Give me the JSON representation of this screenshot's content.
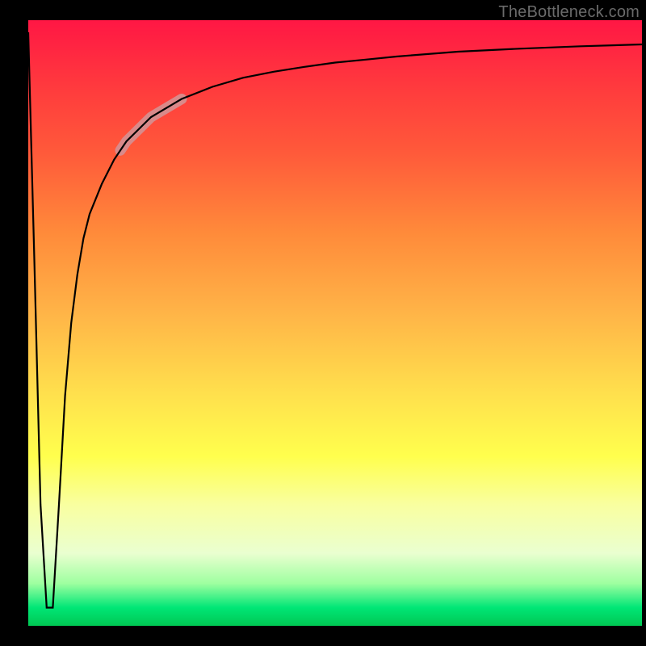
{
  "watermark": "TheBottleneck.com",
  "chart_data": {
    "type": "line",
    "title": "",
    "xlabel": "",
    "ylabel": "",
    "xlim": [
      0,
      100
    ],
    "ylim": [
      0,
      100
    ],
    "grid": false,
    "series": [
      {
        "name": "bottleneck-curve",
        "x": [
          0,
          1,
          2,
          3,
          4,
          5,
          6,
          7,
          8,
          9,
          10,
          12,
          14,
          16,
          18,
          20,
          25,
          30,
          35,
          40,
          45,
          50,
          55,
          60,
          70,
          80,
          90,
          100
        ],
        "values": [
          98,
          60,
          20,
          3,
          3,
          20,
          38,
          50,
          58,
          64,
          68,
          73,
          77,
          80,
          82,
          84,
          87,
          89,
          90.5,
          91.5,
          92.3,
          93,
          93.5,
          94,
          94.8,
          95.3,
          95.7,
          96
        ]
      }
    ],
    "annotations": [
      {
        "name": "highlight-segment",
        "x_range": [
          15,
          25
        ],
        "y_range": [
          79,
          87
        ],
        "style": "thick-pink"
      }
    ],
    "colors": {
      "curve": "#000000",
      "highlight": "#d98a8a",
      "gradient_top": "#ff1744",
      "gradient_mid": "#ffff4d",
      "gradient_bottom": "#00c853",
      "background_outside": "#000000",
      "watermark": "#6a6a6a"
    }
  }
}
